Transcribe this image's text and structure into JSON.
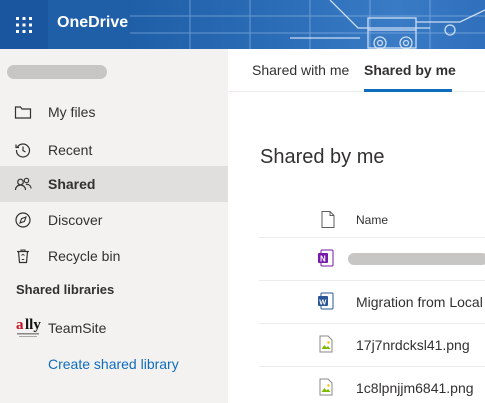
{
  "app": {
    "title": "OneDrive"
  },
  "icons": {
    "waffle": "app-launcher-icon",
    "my_files": "folder-icon",
    "recent": "history-icon",
    "shared": "people-icon",
    "discover": "compass-icon",
    "recycle": "trash-icon",
    "column": "file-icon",
    "onenote": "onenote-icon",
    "word": "word-icon",
    "image": "image-file-icon"
  },
  "colors": {
    "accent": "#0f6cbd",
    "header": "#1f5fa8",
    "onenote": "#7719aa",
    "word": "#2b579a"
  },
  "sidebar": {
    "items": [
      {
        "label": "My files"
      },
      {
        "label": "Recent"
      },
      {
        "label": "Shared"
      },
      {
        "label": "Discover"
      },
      {
        "label": "Recycle bin"
      }
    ],
    "section_heading": "Shared libraries",
    "libraries": [
      {
        "label": "TeamSite"
      }
    ],
    "create_link": "Create shared library"
  },
  "tabs": [
    {
      "label": "Shared with me"
    },
    {
      "label": "Shared by me"
    }
  ],
  "main": {
    "title": "Shared by me",
    "column_name": "Name",
    "files": [
      {
        "name": ""
      },
      {
        "name": "Migration from Local"
      },
      {
        "name": "17j7nrdcksl41.png"
      },
      {
        "name": "1c8lpnjjm6841.png"
      }
    ]
  }
}
